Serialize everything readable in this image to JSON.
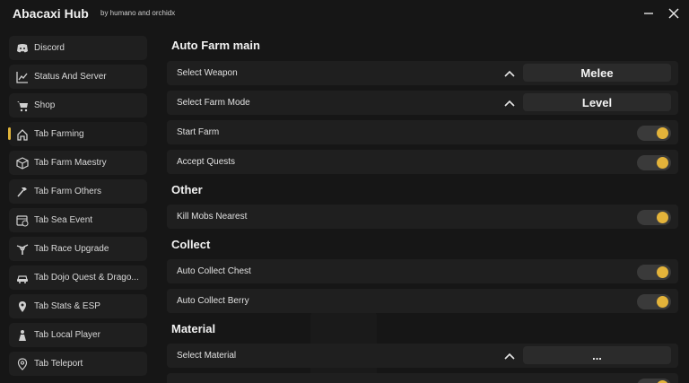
{
  "window": {
    "title": "Abacaxi Hub",
    "subtitle": "by humano and orchidx",
    "accent_color": "#e3b33a"
  },
  "sidebar": {
    "items": [
      {
        "label": "Discord",
        "icon": "discord-icon"
      },
      {
        "label": "Status And Server",
        "icon": "chart-icon"
      },
      {
        "label": "Shop",
        "icon": "cart-icon"
      },
      {
        "label": "Tab Farming",
        "icon": "home-icon",
        "active": true
      },
      {
        "label": "Tab Farm Maestry",
        "icon": "cube-icon"
      },
      {
        "label": "Tab Farm Others",
        "icon": "hammer-icon"
      },
      {
        "label": "Tab Sea Event",
        "icon": "calendar-clock-icon"
      },
      {
        "label": "Tab Race Upgrade",
        "icon": "tree-icon"
      },
      {
        "label": "Tab Dojo Quest & Drago...",
        "icon": "car-icon"
      },
      {
        "label": "Tab Stats & ESP",
        "icon": "pin-icon"
      },
      {
        "label": "Tab Local Player",
        "icon": "person-icon"
      },
      {
        "label": "Tab Teleport",
        "icon": "location-icon"
      }
    ]
  },
  "main": {
    "sections": {
      "auto_farm": "Auto Farm main",
      "other": "Other",
      "collect": "Collect",
      "material": "Material"
    },
    "select_weapon": {
      "label": "Select Weapon",
      "value": "Melee"
    },
    "select_farm_mode": {
      "label": "Select Farm Mode",
      "value": "Level"
    },
    "start_farm": {
      "label": "Start Farm",
      "on": true
    },
    "accept_quests": {
      "label": "Accept Quests",
      "on": true
    },
    "kill_mobs": {
      "label": "Kill Mobs Nearest",
      "on": true
    },
    "auto_collect_chest": {
      "label": "Auto Collect Chest",
      "on": true
    },
    "auto_collect_berry": {
      "label": "Auto Collect Berry",
      "on": true
    },
    "select_material": {
      "label": "Select Material",
      "value": "..."
    }
  }
}
